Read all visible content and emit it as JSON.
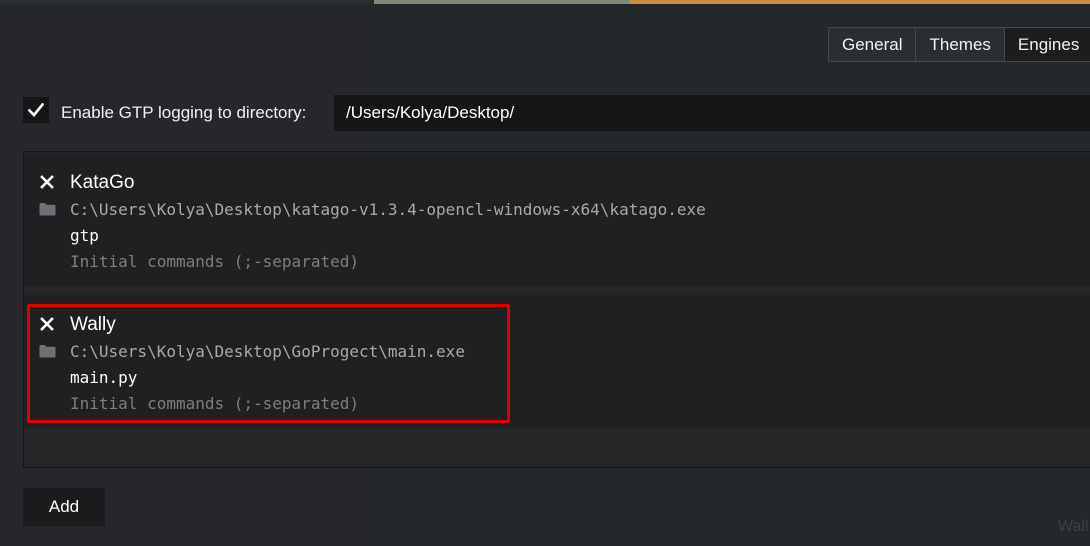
{
  "colors": {
    "background": "#2a2d31",
    "panel": "#1f2022",
    "input_bg": "#141516",
    "highlight_border": "#e00000",
    "muted_text": "#a9a9a9",
    "placeholder_text": "#7e7e7e"
  },
  "tabs": [
    {
      "label": "General",
      "active": false
    },
    {
      "label": "Themes",
      "active": false
    },
    {
      "label": "Engines",
      "active": true
    }
  ],
  "gtp_logging": {
    "checked": true,
    "label": "Enable GTP logging to directory:",
    "path": "/Users/Kolya/Desktop/"
  },
  "engines": [
    {
      "name": "KataGo",
      "path": "C:\\Users\\Kolya\\Desktop\\katago-v1.3.4-opencl-windows-x64\\katago.exe",
      "args": "gtp",
      "commands_placeholder": "Initial commands (;-separated)",
      "remove_icon": "close-icon",
      "folder_icon": "folder-icon"
    },
    {
      "name": "Wally",
      "path": "C:\\Users\\Kolya\\Desktop\\GoProgect\\main.exe",
      "args": "main.py",
      "commands_placeholder": "Initial commands (;-separated)",
      "remove_icon": "close-icon",
      "folder_icon": "folder-icon",
      "highlighted": true
    }
  ],
  "add_button": {
    "label": "Add"
  },
  "background_text": "Wall"
}
